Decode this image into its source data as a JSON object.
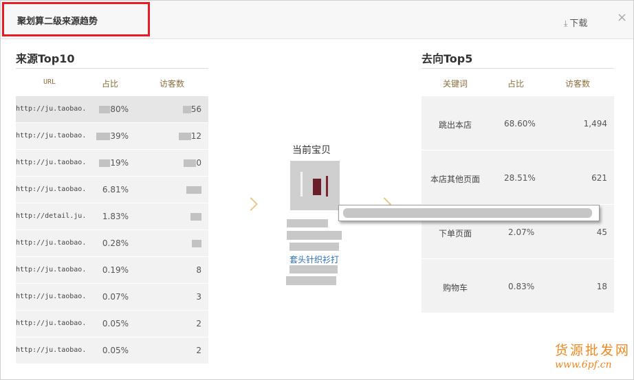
{
  "dialog": {
    "title": "聚划算二级来源趋势",
    "download_label": "下载",
    "close_label": "×"
  },
  "source": {
    "title": "来源Top10",
    "headers": {
      "url": "URL",
      "share": "占比",
      "visitors": "访客数"
    },
    "rows": [
      {
        "url": "http://ju.taobao.",
        "share": "80%",
        "visitors": "56"
      },
      {
        "url": "http://ju.taobao.",
        "share": "39%",
        "visitors": "12"
      },
      {
        "url": "http://ju.taobao.",
        "share": "19%",
        "visitors": "0"
      },
      {
        "url": "http://ju.taobao.",
        "share": "6.81%",
        "visitors": ""
      },
      {
        "url": "http://detail.ju.",
        "share": "1.83%",
        "visitors": ""
      },
      {
        "url": "http://ju.taobao.",
        "share": "0.28%",
        "visitors": ""
      },
      {
        "url": "http://ju.taobao.",
        "share": "0.19%",
        "visitors": "8"
      },
      {
        "url": "http://ju.taobao.",
        "share": "0.07%",
        "visitors": "3"
      },
      {
        "url": "http://ju.taobao.",
        "share": "0.05%",
        "visitors": "2"
      },
      {
        "url": "http://ju.taobao.",
        "share": "0.05%",
        "visitors": "2"
      }
    ]
  },
  "current": {
    "title": "当前宝贝",
    "product_link": "套头针织衫打"
  },
  "destination": {
    "title": "去向Top5",
    "headers": {
      "keyword": "关键词",
      "share": "占比",
      "visitors": "访客数"
    },
    "rows": [
      {
        "keyword": "跳出本店",
        "share": "68.60%",
        "visitors": "1,494"
      },
      {
        "keyword": "本店其他页面",
        "share": "28.51%",
        "visitors": "621"
      },
      {
        "keyword": "下单页面",
        "share": "2.07%",
        "visitors": "45"
      },
      {
        "keyword": "购物车",
        "share": "0.83%",
        "visitors": "18"
      }
    ]
  },
  "watermark": {
    "line1": "货源批发网",
    "line2": "www.6pf.cn"
  },
  "colors": {
    "highlight": "#e81c24",
    "header_text": "#8a6d3b",
    "link": "#2a6fb5",
    "watermark": "#f08820"
  }
}
